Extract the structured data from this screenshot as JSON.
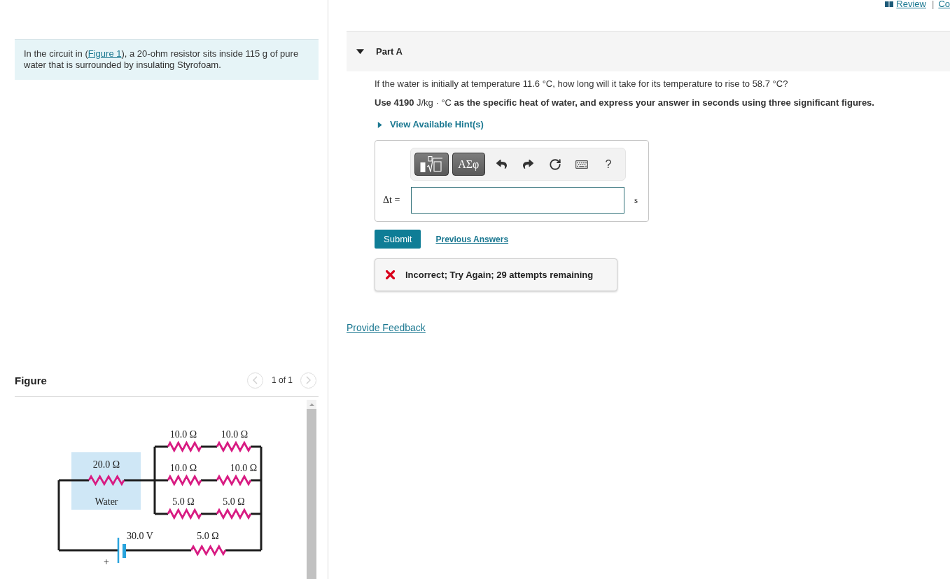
{
  "top_links": {
    "review": "Review",
    "separator": "|",
    "next": "Co"
  },
  "problem": {
    "before": "In the circuit in (",
    "link": "Figure 1",
    "after": "), a 20-ohm resistor sits inside 115 g of pure water that is surrounded by insulating Styrofoam."
  },
  "figure": {
    "title": "Figure",
    "pager": {
      "label": "1 of 1",
      "prev_disabled": true,
      "next_disabled": true
    },
    "circuit": {
      "water_resistor": "20.0 Ω",
      "water_label": "Water",
      "parallel_rows": [
        {
          "left": "10.0 Ω",
          "right": "10.0 Ω"
        },
        {
          "left": "10.0 Ω",
          "right": "10.0 Ω"
        },
        {
          "left": "5.0 Ω",
          "right": "5.0 Ω"
        }
      ],
      "battery": {
        "voltage": "30.0 V",
        "terminal": "+"
      },
      "series_resistor": "5.0 Ω"
    }
  },
  "part": {
    "title": "Part A",
    "expanded": true,
    "question": "If the water is initially at temperature 11.6 °C, how long will it take for its temperature to rise to 58.7 °C?",
    "instruction": "**Use 4190** J/kg · °C **as the specific heat of water, and express your answer in seconds using three significant figures.**",
    "hints": {
      "label": "View Available Hint(s)",
      "expanded": false
    },
    "answer": {
      "toolbar": [
        {
          "kind": "templates"
        },
        {
          "kind": "symbols",
          "label": "ΑΣφ"
        },
        {
          "kind": "undo"
        },
        {
          "kind": "redo"
        },
        {
          "kind": "reset"
        },
        {
          "kind": "keyboard"
        },
        {
          "kind": "help",
          "label": "?"
        }
      ],
      "variable": "Δt =",
      "unit": "s"
    },
    "submit": "Submit",
    "previous_answers": "Previous Answers",
    "feedback": {
      "correct": false,
      "message": "Incorrect; Try Again; 29 attempts remaining"
    }
  },
  "provide_feedback": "Provide Feedback"
}
